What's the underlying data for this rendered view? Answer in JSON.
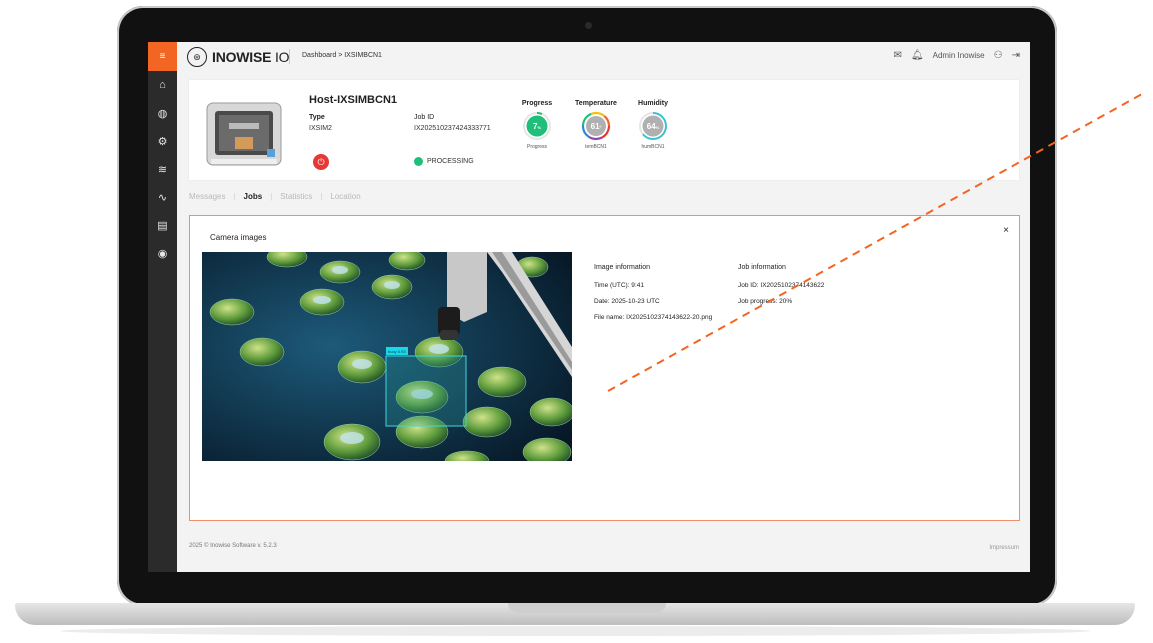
{
  "app": {
    "logo_mark": "⊛",
    "logo_bold": "INOWISE",
    "logo_light": " IO",
    "breadcrumb": "Dashboard > IXSIMBCN1",
    "user_name": "Admin Inowise",
    "menu_icon": "≡"
  },
  "sidebar": {
    "items": [
      {
        "icon": "home-icon",
        "glyph": "⌂"
      },
      {
        "icon": "globe-icon",
        "glyph": "◍"
      },
      {
        "icon": "settings-icon",
        "glyph": "⚙"
      },
      {
        "icon": "wifi-icon",
        "glyph": "≋"
      },
      {
        "icon": "pulse-icon",
        "glyph": "∿"
      },
      {
        "icon": "printer-icon",
        "glyph": "▤"
      },
      {
        "icon": "location-icon",
        "glyph": "◉"
      }
    ]
  },
  "host": {
    "title": "Host-IXSIMBCN1",
    "type_label": "Type",
    "type_value": "IXSIM2",
    "jobid_label": "Job ID",
    "jobid_value": "IX202510237424333771",
    "status": "PROCESSING",
    "power_glyph": "⏻"
  },
  "gauges": [
    {
      "title": "Progress",
      "value": "7",
      "unit": "%",
      "sub": "Progress",
      "color": "#1fbf7a"
    },
    {
      "title": "Temperature",
      "value": "61",
      "unit": "º",
      "sub": "temBCN1",
      "color": "#c9c9c9"
    },
    {
      "title": "Humidity",
      "value": "64",
      "unit": "%",
      "sub": "humBCN1",
      "color": "#c9c9c9"
    }
  ],
  "tabs": [
    "Messages",
    "Jobs",
    "Statistics",
    "Location"
  ],
  "active_tab": "Jobs",
  "camera": {
    "title": "Camera images",
    "close": "×",
    "overlay_label": "buoy 0.93"
  },
  "image_info": {
    "heading": "Image information",
    "time": "Time (UTC): 9:41",
    "date": "Date: 2025-10-23 UTC",
    "file": "File name: IX2025102374143622-20.png"
  },
  "job_info": {
    "heading": "Job information",
    "job_id": "Job ID: IX2025102374143622",
    "progress": "Job progress: 20%"
  },
  "footer": {
    "left": "2025 © Inowise Software v. 5.2.3",
    "right": "Impressum"
  },
  "colors": {
    "accent": "#f26522",
    "status_green": "#1fbf7a",
    "sidebar": "#2b2b2b"
  }
}
